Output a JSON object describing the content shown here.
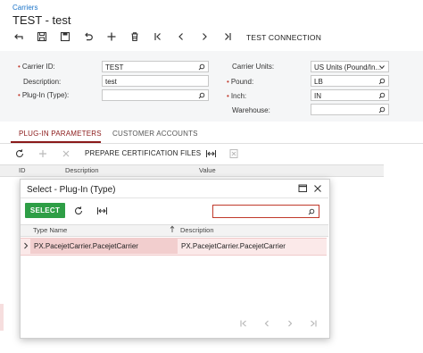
{
  "header": {
    "breadcrumb": "Carriers",
    "title": "TEST - test"
  },
  "toolbar": {
    "test_connection": "TEST CONNECTION"
  },
  "form": {
    "carrier_id_label": "Carrier ID:",
    "carrier_id_value": "TEST",
    "description_label": "Description:",
    "description_value": "test",
    "plugin_label": "Plug-In (Type):",
    "plugin_value": "",
    "carrier_units_label": "Carrier Units:",
    "carrier_units_value": "US Units (Pound/In...",
    "pound_label": "Pound:",
    "pound_value": "LB",
    "inch_label": "Inch:",
    "inch_value": "IN",
    "warehouse_label": "Warehouse:",
    "warehouse_value": ""
  },
  "tabs": {
    "plugin_parameters": "PLUG-IN PARAMETERS",
    "customer_accounts": "CUSTOMER ACCOUNTS"
  },
  "grid": {
    "prepare_label": "PREPARE CERTIFICATION FILES",
    "col_id": "ID",
    "col_description": "Description",
    "col_value": "Value"
  },
  "dialog": {
    "title": "Select - Plug-In (Type)",
    "select_label": "SELECT",
    "search_value": "",
    "col_type_name": "Type Name",
    "col_description": "Description",
    "row_type_name": "PX.PacejetCarrier.PacejetCarrier",
    "row_description": "PX.PacejetCarrier.PacejetCarrier"
  },
  "colors": {
    "accent": "#8b1a1a",
    "select_button": "#2e9e46",
    "link": "#1a73c8",
    "required": "#c0392b"
  }
}
